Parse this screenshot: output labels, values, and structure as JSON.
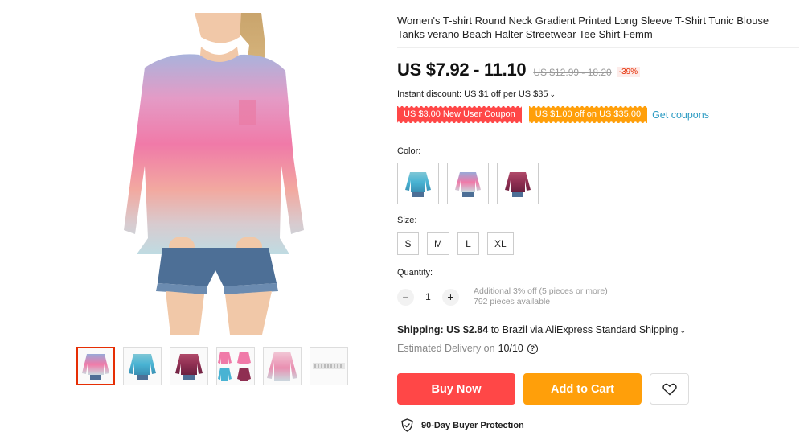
{
  "product": {
    "title": "Women's T-shirt Round Neck Gradient Printed Long Sleeve T-Shirt Tunic Blouse Tanks verano Beach Halter Streetwear Tee Shirt Femm",
    "price": "US $7.92 - 11.10",
    "original_price": "US $12.99 - 18.20",
    "discount_percent": "-39%",
    "instant_discount": "Instant discount: US $1 off per US $35",
    "coupons": [
      {
        "label": "US $3.00 New User Coupon",
        "color": "#ff4747"
      },
      {
        "label": "US $1.00 off on US $35.00",
        "color": "#ff9f0a"
      }
    ],
    "get_coupons_label": "Get coupons"
  },
  "gallery": {
    "thumbnails": [
      {
        "name": "pink-gradient",
        "colors": [
          "#9aa9d8",
          "#f07aa8",
          "#c9dbe0"
        ],
        "active": true
      },
      {
        "name": "blue-gradient",
        "colors": [
          "#7fc7d6",
          "#49b3d3",
          "#3a8fb3"
        ],
        "active": false
      },
      {
        "name": "wine-gradient",
        "colors": [
          "#b04a6a",
          "#8f2f52",
          "#6b2040"
        ],
        "active": false
      },
      {
        "name": "color-collage",
        "colors": [
          "#f07aa8",
          "#49b3d3",
          "#8f2f52"
        ],
        "active": false
      },
      {
        "name": "flat-gradient",
        "colors": [
          "#f2c8d6",
          "#e98fb1",
          "#c9dbe0"
        ],
        "active": false
      },
      {
        "name": "size-chart",
        "colors": [
          "#d8d8d8",
          "#c8c8c8",
          "#e8e8e8"
        ],
        "active": false
      }
    ]
  },
  "options": {
    "color_label": "Color:",
    "colors": [
      {
        "name": "blue",
        "swatch": [
          "#7fc7d6",
          "#49b3d3",
          "#3a8fb3"
        ]
      },
      {
        "name": "pink",
        "swatch": [
          "#9aa9d8",
          "#f07aa8",
          "#c9dbe0"
        ]
      },
      {
        "name": "wine",
        "swatch": [
          "#b04a6a",
          "#8f2f52",
          "#6b2040"
        ]
      }
    ],
    "size_label": "Size:",
    "sizes": [
      "S",
      "M",
      "L",
      "XL"
    ],
    "quantity_label": "Quantity:",
    "quantity_value": "1",
    "quantity_note_1": "Additional 3% off (5 pieces or more)",
    "quantity_note_2": "792 pieces available"
  },
  "shipping": {
    "label": "Shipping: US $2.84",
    "destination": "to Brazil via AliExpress Standard Shipping",
    "estimated_label": "Estimated Delivery on",
    "estimated_date": "10/10"
  },
  "actions": {
    "buy_now": "Buy Now",
    "add_to_cart": "Add to Cart"
  },
  "protection": {
    "label": "90-Day Buyer Protection"
  },
  "accent_colors": {
    "red": "#ff4747",
    "orange": "#ff9f0a",
    "link": "#2e9cc3"
  }
}
